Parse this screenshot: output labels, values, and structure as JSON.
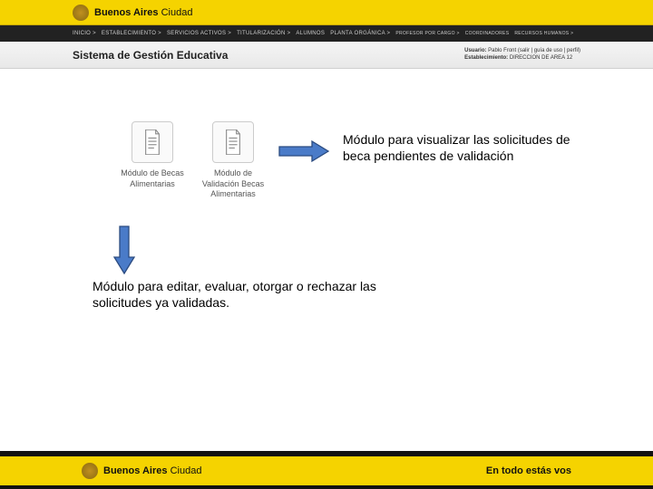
{
  "brand": {
    "bold": "Buenos Aires",
    "thin": "Ciudad"
  },
  "nav": {
    "items": [
      "INICIO >",
      "ESTABLECIMIENTO >",
      "SERVICIOS ACTIVOS >",
      "TITULARIZACIÓN >",
      "ALUMNOS",
      "PLANTA ORGÁNICA >",
      "PROFESOR POR CARGO >",
      "COORDINADORES",
      "RECURSOS HUMANOS >"
    ]
  },
  "header": {
    "system_title": "Sistema de Gestión Educativa",
    "user_label": "Usuario:",
    "user_value": "Pablo Front (salir | guía de uso | perfil)",
    "estab_label": "Establecimiento:",
    "estab_value": "DIRECCION DE AREA 12"
  },
  "modules": {
    "becas": {
      "label": "Módulo de Becas Alimentarias"
    },
    "validacion": {
      "label": "Módulo de Validación Becas Alimentarias"
    }
  },
  "annotations": {
    "right": "Módulo para visualizar las solicitudes de beca pendientes de validación",
    "down": "Módulo para editar, evaluar, otorgar o rechazar las solicitudes ya validadas."
  },
  "footer": {
    "slogan": "En todo estás vos"
  }
}
